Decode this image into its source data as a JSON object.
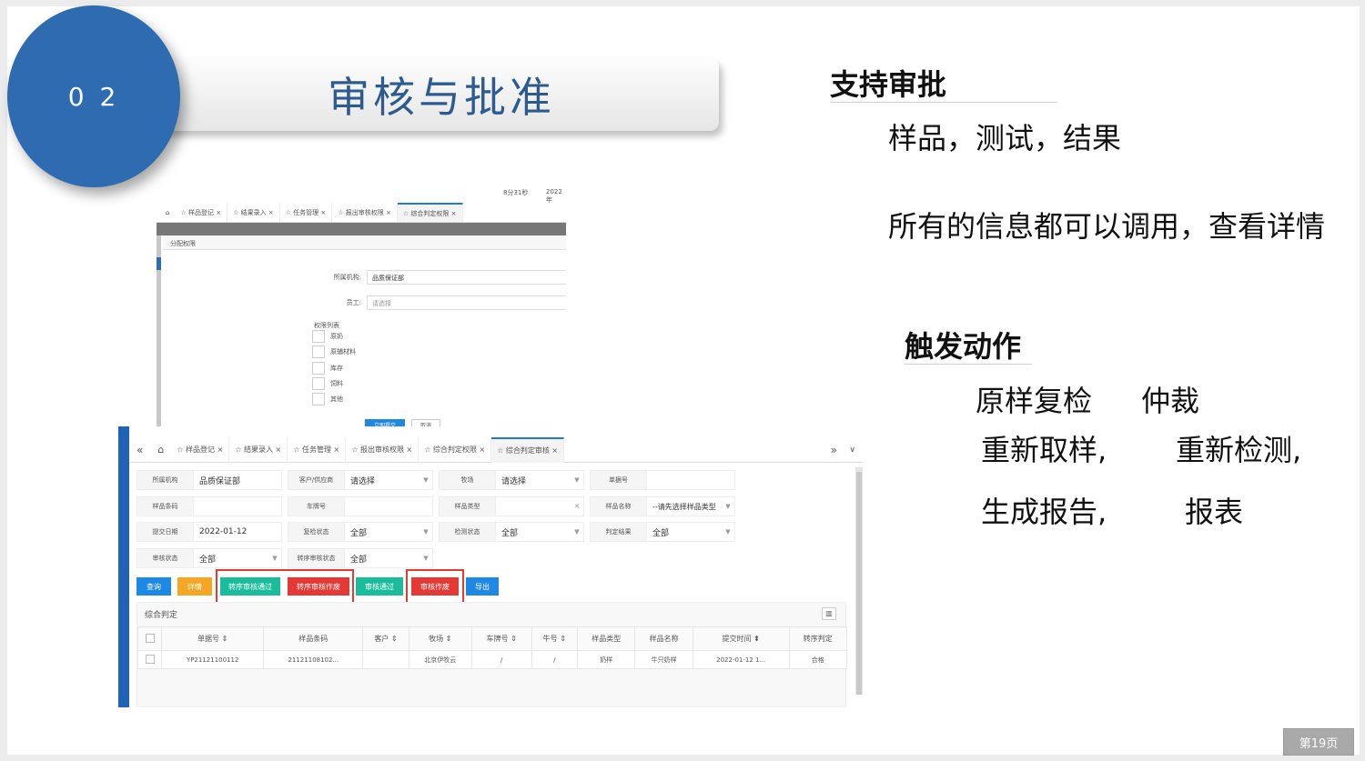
{
  "slide": {
    "number": "0 2",
    "title": "审核与批准",
    "page_badge": "第19页"
  },
  "right": {
    "heading1": "支持审批",
    "line1": "样品，测试，结果",
    "line2": "所有的信息都可以调用，查看详情",
    "heading2": "触发动作",
    "actions": [
      "原样复检",
      "仲裁",
      "重新取样,",
      "重新检测,",
      "生成报告,",
      "报表"
    ]
  },
  "shot1": {
    "top_info": [
      "8分31秒",
      "2022年"
    ],
    "tabs": [
      "样品登记",
      "结果录入",
      "任务管理",
      "报出审核权限",
      "综合判定权限"
    ],
    "modal_title": "分配权限",
    "org_label": "所属机构:",
    "org_value": "品质保证部",
    "staff_label": "员工:",
    "staff_placeholder": "请选择",
    "perm_list_label": "权限列表",
    "perms": [
      "原奶",
      "原辅材料",
      "库存",
      "饲料",
      "其他"
    ],
    "btn_ok": "立即提交",
    "btn_cancel": "取消"
  },
  "shot2": {
    "tabs": [
      "样品登记",
      "结果录入",
      "任务管理",
      "报出审核权限",
      "综合判定权限",
      "综合判定审核"
    ],
    "fields": [
      {
        "label": "所属机构",
        "value": "品质保证部"
      },
      {
        "label": "客户/供应商",
        "value": "请选择"
      },
      {
        "label": "牧场",
        "value": "请选择"
      },
      {
        "label": "单据号",
        "value": ""
      },
      {
        "label": "样品条码",
        "value": ""
      },
      {
        "label": "车牌号",
        "value": ""
      },
      {
        "label": "样品类型",
        "value": ""
      },
      {
        "label": "样品名称",
        "value": "--请先选择样品类型"
      },
      {
        "label": "提交日期",
        "value": "2022-01-12"
      },
      {
        "label": "复检状态",
        "value": "全部"
      },
      {
        "label": "检测状态",
        "value": "全部"
      },
      {
        "label": "判定结果",
        "value": "全部"
      },
      {
        "label": "审核状态",
        "value": "全部"
      },
      {
        "label": "转序审核状态",
        "value": "全部"
      }
    ],
    "buttons": [
      "查询",
      "详情",
      "转序审核通过",
      "转序审核作废",
      "审核通过",
      "审核作废",
      "导出"
    ],
    "panel_title": "综合判定",
    "columns": [
      "单据号",
      "样品条码",
      "客户",
      "牧场",
      "车牌号",
      "牛号",
      "样品类型",
      "样品名称",
      "提交时间",
      "转序判定"
    ],
    "row": [
      "YP21121100112",
      "21121108102...",
      "",
      "北京伊牧云",
      "/",
      "/",
      "奶样",
      "牛只奶样",
      "2022-01-12 1...",
      "合格"
    ],
    "colors": {
      "blue": "#1e88e5",
      "orange": "#f5a623",
      "green": "#1abc9c",
      "red": "#e53935"
    }
  }
}
